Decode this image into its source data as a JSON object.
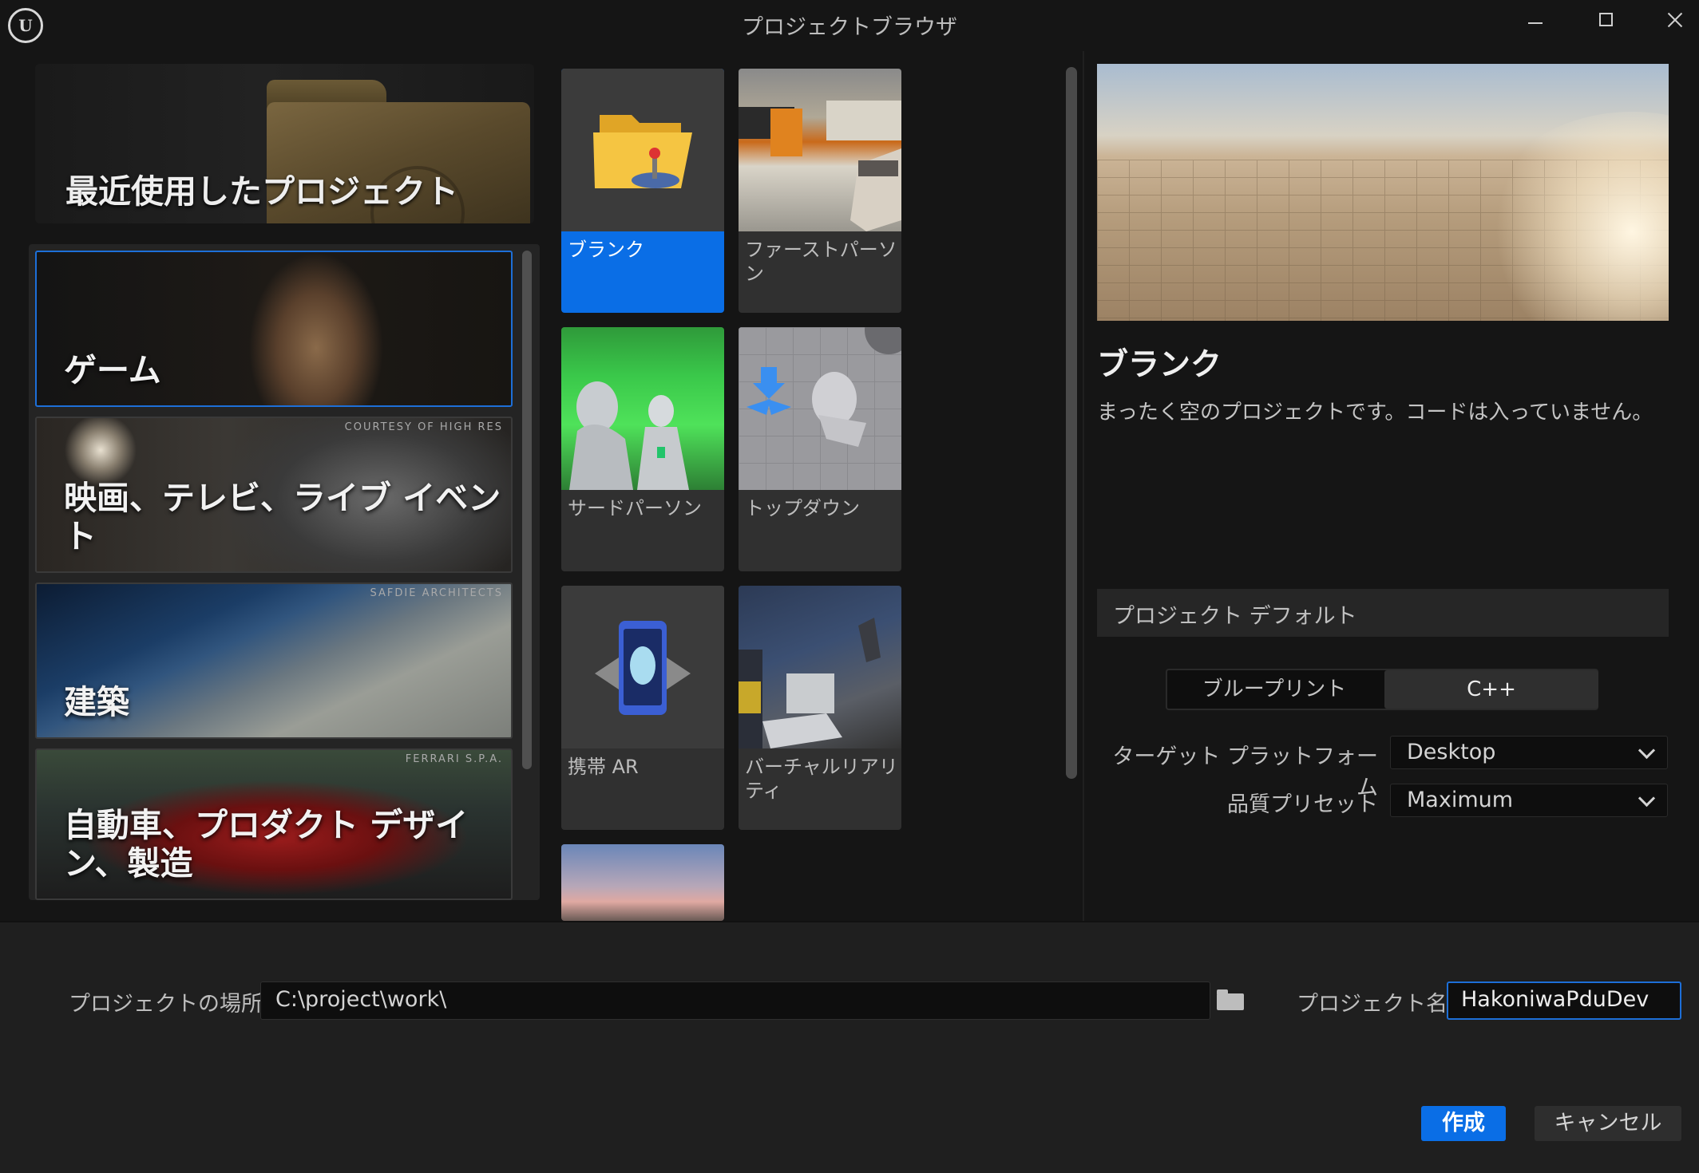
{
  "window": {
    "title": "プロジェクトブラウザ",
    "logo_text": "U"
  },
  "recent": {
    "label": "最近使用したプロジェクト"
  },
  "categories": [
    {
      "label": "ゲーム",
      "credit": "",
      "selected": true
    },
    {
      "label": "映画、テレビ、ライブ イベント",
      "credit": "COURTESY OF HIGH RES",
      "selected": false
    },
    {
      "label": "建築",
      "credit": "SAFDIE ARCHITECTS",
      "selected": false
    },
    {
      "label": "自動車、プロダクト デザイン、製造",
      "credit": "FERRARI S.P.A.",
      "selected": false
    }
  ],
  "templates": [
    {
      "label": "ブランク",
      "selected": true
    },
    {
      "label": "ファーストパーソン",
      "selected": false
    },
    {
      "label": "サードパーソン",
      "selected": false
    },
    {
      "label": "トップダウン",
      "selected": false
    },
    {
      "label": "携帯 AR",
      "selected": false
    },
    {
      "label": "バーチャルリアリティ",
      "selected": false
    }
  ],
  "detail": {
    "title": "ブランク",
    "description": "まったく空のプロジェクトです。コードは入っていません。"
  },
  "defaults": {
    "header": "プロジェクト デフォルト",
    "lang_options": [
      "ブループリント",
      "C++"
    ],
    "lang_selected": "C++",
    "target_label": "ターゲット プラットフォーム",
    "target_value": "Desktop",
    "quality_label": "品質プリセット",
    "quality_value": "Maximum"
  },
  "bottom": {
    "location_label": "プロジェクトの場所",
    "location_value": "C:\\project\\work\\",
    "name_label": "プロジェクト名",
    "name_value": "HakoniwaPduDev",
    "create_label": "作成",
    "cancel_label": "キャンセル"
  },
  "colors": {
    "accent": "#0a6ee6",
    "background": "#151515",
    "panel": "#242424"
  },
  "icons": [
    "unreal-logo-icon",
    "minimize-icon",
    "maximize-icon",
    "close-icon",
    "folder-browse-icon",
    "chevron-down-icon"
  ]
}
